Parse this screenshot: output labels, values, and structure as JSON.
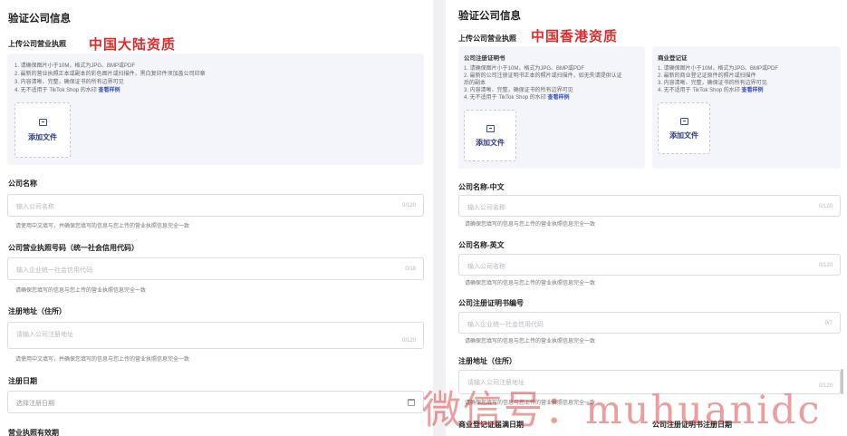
{
  "left": {
    "page_title": "验证公司信息",
    "upload_label": "上传公司营业执照",
    "annotation": "中国大陆资质",
    "requirements": [
      "1. 请确保图片小于10M，格式为JPG、BMP或PDF",
      "2. 最新的营业执照正本或副本的彩色图片或扫描件，黑白复印件须加盖公司印章",
      "3. 内容清晰、完整，确保证书的所有边界可见",
      "4. 无不适用于 TikTok Shop 的水印"
    ],
    "view_sample": "查看样例",
    "add_file": "添加文件",
    "company_name": {
      "label": "公司名称",
      "placeholder": "输入公司名称",
      "count": "0/120",
      "hint": "请使用中文填写，并确保您填写的信息与您上传的营业执照信息完全一致"
    },
    "license_number": {
      "label": "公司营业执照号码（统一社会信用代码）",
      "placeholder": "输入企业统一社会信用代码",
      "count": "0/18",
      "hint": "请确保您填写的信息与您上传的营业执照信息完全一致"
    },
    "address": {
      "label": "注册地址（住所）",
      "placeholder": "请输入公司注册地址",
      "count": "0/120",
      "hint": "请使用中文填写，并确保您填写的信息与您上传的营业执照信息完全一致"
    },
    "reg_date": {
      "label": "注册日期",
      "placeholder": "选择注册日期"
    },
    "validity_label": "营业执照有效期"
  },
  "right": {
    "page_title": "验证公司信息",
    "upload_label": "上传公司营业执照",
    "annotation": "中国香港资质",
    "cert_incorp": {
      "title": "公司注册证明书",
      "lines": [
        "1. 请确保图片小于10M，格式为JPG、BMP或PDF",
        "2. 最新的公司注册证明书正本的照片或扫描件，如无失请提供认证",
        "后的副本",
        "3. 内容清晰、完整，确保证书的所有边界可见",
        "4. 无不适用于 TikTok Shop 的水印"
      ],
      "view_sample": "查看样例",
      "add_file": "添加文件"
    },
    "business_reg": {
      "title": "商业登记证",
      "lines": [
        "1. 请确保图片小于10M，格式为JPG、BMP或PDF",
        "2. 最新的商业登记证原件的照片或扫描件",
        "3. 内容清晰、完整，确保证书的所有边界可见",
        "4. 无不适用于 TikTok Shop 的水印"
      ],
      "view_sample": "查看样例",
      "add_file": "添加文件"
    },
    "name_cn": {
      "label": "公司名称-中文",
      "placeholder": "输入公司名称",
      "count": "0/120",
      "hint": "请确保您填写的信息与您上传的营业执照信息完全一致"
    },
    "name_en": {
      "label": "公司名称-英文",
      "placeholder": "输入公司名称",
      "count": "0/120",
      "hint": "请确保您填写的信息与您上传的营业执照信息完全一致"
    },
    "cert_number": {
      "label": "公司注册证明书编号",
      "placeholder": "输入企业统一社会信用代码",
      "count": "0/7",
      "hint": "请确保您填写的信息与您上传的营业执照信息完全一致"
    },
    "address": {
      "label": "注册地址（住所）",
      "placeholder": "请输入公司注册地址",
      "count": "0/120",
      "hint": "请确保您填写的信息与您上传的营业执照信息完全一致"
    },
    "br_expiry_label": "商业登记证届满日期",
    "ci_reg_date_label": "公司注册证明书注册日期"
  },
  "watermark": "微信号：muhuanidc",
  "colors": {
    "annotation": "#e02b2b",
    "link": "#3450c9",
    "upload_accent": "#2f3a86",
    "requirements_bg": "#f4f5fa"
  }
}
